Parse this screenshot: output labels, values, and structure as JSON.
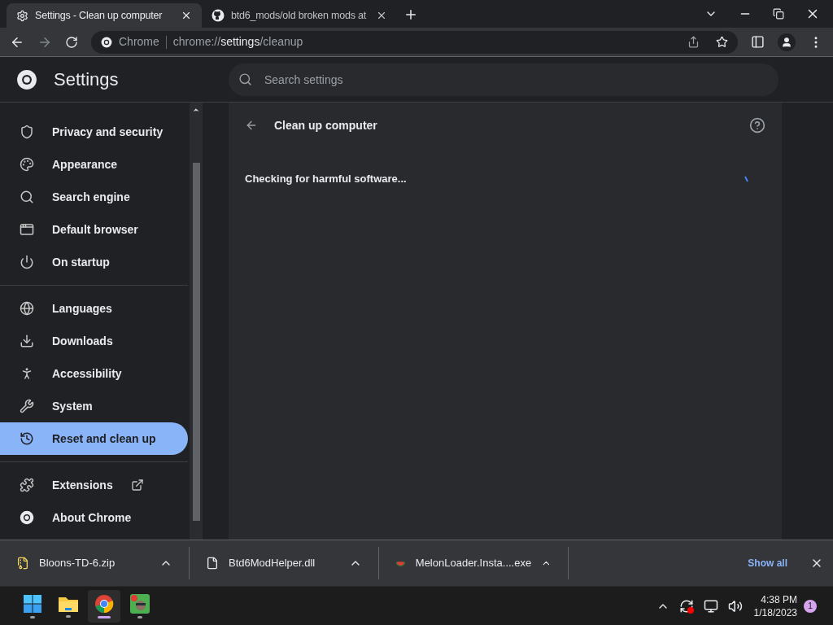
{
  "tabs": [
    {
      "title": "Settings - Clean up computer",
      "selected": true
    },
    {
      "title": "btd6_mods/old broken mods at",
      "selected": false
    }
  ],
  "address": {
    "site": "Chrome",
    "scheme": "chrome://",
    "host": "settings",
    "path": "/cleanup"
  },
  "header": {
    "title": "Settings",
    "search_placeholder": "Search settings"
  },
  "sidebar": {
    "groups": [
      [
        {
          "label": "Privacy and security",
          "selected": false
        },
        {
          "label": "Appearance",
          "selected": false
        },
        {
          "label": "Search engine",
          "selected": false
        },
        {
          "label": "Default browser",
          "selected": false
        },
        {
          "label": "On startup",
          "selected": false
        }
      ],
      [
        {
          "label": "Languages",
          "selected": false
        },
        {
          "label": "Downloads",
          "selected": false
        },
        {
          "label": "Accessibility",
          "selected": false
        },
        {
          "label": "System",
          "selected": false
        },
        {
          "label": "Reset and clean up",
          "selected": true
        }
      ],
      [
        {
          "label": "Extensions",
          "selected": false,
          "external": true
        },
        {
          "label": "About Chrome",
          "selected": false,
          "external": false
        }
      ]
    ]
  },
  "page": {
    "title": "Clean up computer",
    "status": "Checking for harmful software..."
  },
  "downloads": {
    "items": [
      {
        "name": "Bloons-TD-6.zip"
      },
      {
        "name": "Btd6ModHelper.dll"
      },
      {
        "name": "MelonLoader.Insta....exe"
      }
    ],
    "show_all": "Show all"
  },
  "taskbar": {
    "time": "4:38 PM",
    "date": "1/18/2023",
    "notifications": "1",
    "apps": [
      {
        "selected": false
      },
      {
        "selected": false
      },
      {
        "selected": true
      },
      {
        "selected": false
      }
    ]
  }
}
